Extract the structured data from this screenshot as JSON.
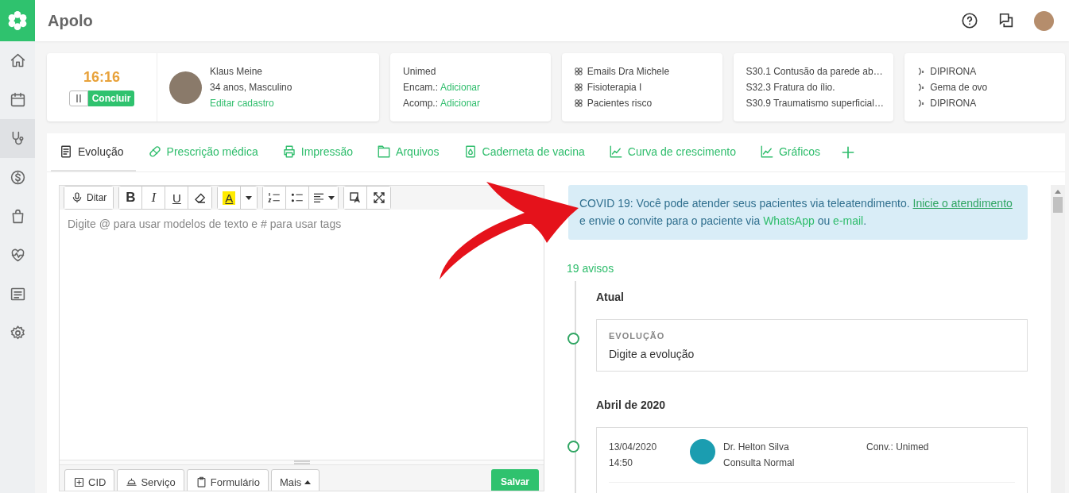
{
  "app": {
    "title": "Apolo"
  },
  "sidebar": {
    "items": [
      {
        "kind": "home",
        "selected": false
      },
      {
        "kind": "calendar",
        "selected": false
      },
      {
        "kind": "stethoscope",
        "selected": true
      },
      {
        "kind": "money",
        "selected": false
      },
      {
        "kind": "bag",
        "selected": false
      },
      {
        "kind": "heart",
        "selected": false
      },
      {
        "kind": "list",
        "selected": false
      },
      {
        "kind": "gear",
        "selected": false
      }
    ]
  },
  "timer": {
    "time": "16:16",
    "button": "Concluir"
  },
  "patient": {
    "name": "Klaus Meine",
    "details": "34 anos, Masculino",
    "link": "Editar cadastro"
  },
  "insurance": {
    "name": "Unimed",
    "rows": [
      {
        "label": "Encam.:",
        "link": "Adicionar"
      },
      {
        "label": "Acomp.:",
        "link": "Adicionar"
      }
    ]
  },
  "groups": [
    "Emails Dra Michele",
    "Fisioterapia I",
    "Pacientes risco"
  ],
  "diagnoses": [
    "S30.1 Contusão da parede ab…",
    "S32.3 Fratura do ílio.",
    "S30.9 Traumatismo superficial…"
  ],
  "allergies": [
    "DIPIRONA",
    "Gema de ovo",
    "DIPIRONA"
  ],
  "tabs": [
    {
      "kind": "document",
      "label": "Evolução",
      "selected": true
    },
    {
      "kind": "pill",
      "label": "Prescrição médica",
      "selected": false
    },
    {
      "kind": "printer",
      "label": "Impressão",
      "selected": false
    },
    {
      "kind": "folder",
      "label": "Arquivos",
      "selected": false
    },
    {
      "kind": "drop",
      "label": "Caderneta de vacina",
      "selected": false
    },
    {
      "kind": "chart",
      "label": "Curva de crescimento",
      "selected": false
    },
    {
      "kind": "chart",
      "label": "Gráficos",
      "selected": false
    }
  ],
  "editor": {
    "toolbar": {
      "dictate": "Ditar",
      "bold": "B",
      "italic": "I",
      "underline": "U",
      "highlight": "A"
    },
    "placeholder": "Digite @ para usar modelos de texto e # para usar tags",
    "footer_buttons": [
      {
        "kind": "cid",
        "label": "CID"
      },
      {
        "kind": "service",
        "label": "Serviço"
      },
      {
        "kind": "form",
        "label": "Formulário"
      },
      {
        "kind": "more",
        "label": "Mais"
      }
    ],
    "save": "Salvar"
  },
  "notice": {
    "parts": [
      {
        "kind": "text",
        "text": "COVID 19: Você pode atender seus pacientes via teleatendimento. "
      },
      {
        "kind": "underlined_link",
        "text": "Inicie o atendimento"
      },
      {
        "kind": "text",
        "text": " e envie o convite para o paciente via "
      },
      {
        "kind": "link",
        "text": "WhatsApp"
      },
      {
        "kind": "text",
        "text": " ou "
      },
      {
        "kind": "link",
        "text": "e-mail"
      },
      {
        "kind": "text",
        "text": "."
      }
    ]
  },
  "timeline": {
    "count": "19 avisos",
    "sections": [
      {
        "heading": "Atual",
        "entries": [
          {
            "kind": "draft",
            "label": "EVOLUÇÃO",
            "text": "Digite a evolução"
          }
        ]
      },
      {
        "heading": "Abril de 2020",
        "entries": [
          {
            "kind": "visit",
            "date": "13/04/2020",
            "time": "14:50",
            "doctor": "Dr. Helton Silva",
            "type": "Consulta Normal",
            "insurance": "Conv.: Unimed"
          }
        ]
      }
    ]
  }
}
